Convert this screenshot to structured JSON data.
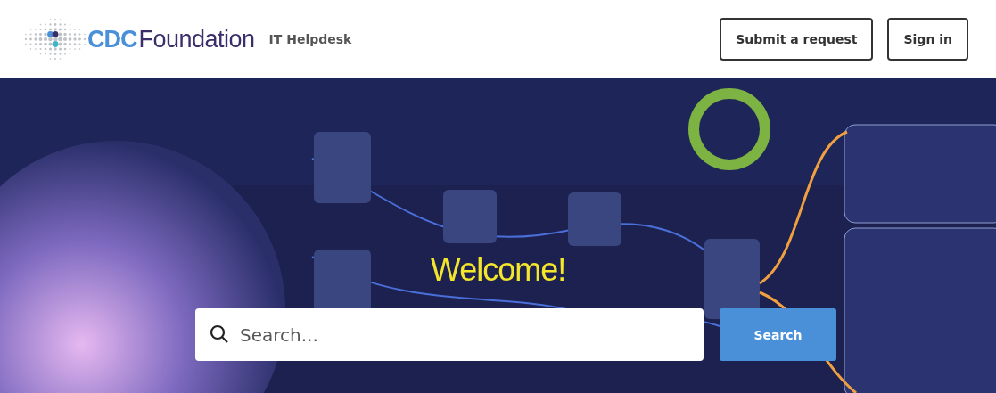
{
  "header": {
    "logo": {
      "mark": "CDC",
      "name": "Foundation"
    },
    "site_name": "IT Helpdesk",
    "buttons": [
      "Submit a request",
      "Sign in"
    ]
  },
  "hero": {
    "kind": "picture",
    "heading": "Welcome!",
    "search": {
      "placeholder": "Search...",
      "button": "Search"
    }
  }
}
